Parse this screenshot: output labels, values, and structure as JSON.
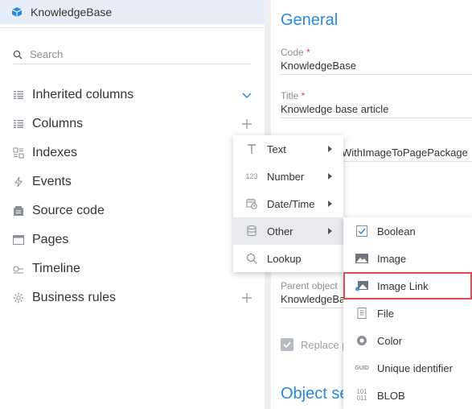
{
  "object": {
    "name": "KnowledgeBase"
  },
  "search": {
    "placeholder": "Search"
  },
  "nav": {
    "items": [
      {
        "label": "Inherited columns",
        "icon": "columns-icon",
        "right_icon": "chevron-down-icon"
      },
      {
        "label": "Columns",
        "icon": "columns-icon",
        "right_icon": "plus-icon"
      },
      {
        "label": "Indexes",
        "icon": "index-icon"
      },
      {
        "label": "Events",
        "icon": "lightning-icon"
      },
      {
        "label": "Source code",
        "icon": "source-code-icon"
      },
      {
        "label": "Pages",
        "icon": "page-icon"
      },
      {
        "label": "Timeline",
        "icon": "timeline-icon"
      },
      {
        "label": "Business rules",
        "icon": "gear-icon",
        "right_icon": "plus-icon"
      }
    ]
  },
  "general": {
    "title": "General",
    "code_label": "Code",
    "code_value": "KnowledgeBase",
    "title_label": "Title",
    "title_value": "Knowledge base article",
    "package_fragment": "WithImageToPagePackage",
    "parent_label": "Parent object",
    "parent_value": "KnowledgeBase",
    "replace_label": "Replace p"
  },
  "object_settings_title": "Object se",
  "menu_types": {
    "items": [
      {
        "label": "Text",
        "icon": "text-icon",
        "submenu": true
      },
      {
        "label": "Number",
        "icon": "number-icon",
        "icon_text": "123",
        "submenu": true
      },
      {
        "label": "Date/Time",
        "icon": "datetime-icon",
        "submenu": true
      },
      {
        "label": "Other",
        "icon": "database-icon",
        "submenu": true,
        "active": true
      },
      {
        "label": "Lookup",
        "icon": "search-icon",
        "submenu": false
      }
    ]
  },
  "menu_other": {
    "items": [
      {
        "label": "Boolean",
        "icon": "checkbox-icon"
      },
      {
        "label": "Image",
        "icon": "image-icon"
      },
      {
        "label": "Image Link",
        "icon": "image-link-icon",
        "highlighted": true
      },
      {
        "label": "File",
        "icon": "file-icon"
      },
      {
        "label": "Color",
        "icon": "color-icon"
      },
      {
        "label": "Unique identifier",
        "icon": "guid-icon",
        "icon_text": "GUID"
      },
      {
        "label": "BLOB",
        "icon": "blob-icon",
        "icon_text": "101\n011"
      }
    ]
  },
  "colors": {
    "accent": "#2a8ad8",
    "highlight_border": "#e04b4b",
    "header_bg": "#e8eef8"
  }
}
